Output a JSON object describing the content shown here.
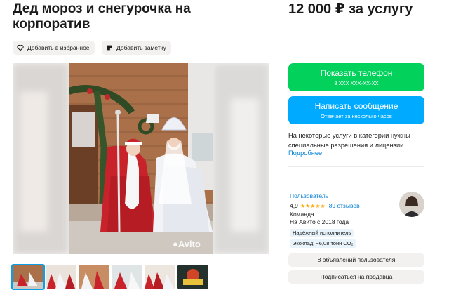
{
  "listing": {
    "title": "Дед мороз и снегурочка на корпоратив",
    "price": "12 000 ₽ за услугу"
  },
  "actions": {
    "favorite_label": "Добавить в избранное",
    "note_label": "Добавить заметку"
  },
  "gallery": {
    "watermark": "Avito",
    "thumbnail_count": 6
  },
  "contact": {
    "phone_button": "Показать телефон",
    "phone_masked": "8 XXX XXX-XX-XX",
    "message_button": "Написать сообщение",
    "message_sub": "Отвечает за несколько часов"
  },
  "notice": {
    "text": "На некоторые услуги в категории нужны специальные разрешения и лицензии.",
    "link": "Подробнее"
  },
  "seller": {
    "name": "Пользователь",
    "rating": "4,9",
    "stars": "★★★★★",
    "reviews": "89 отзывов",
    "type": "Команда",
    "since": "На Авито с 2018 года",
    "badge_reliable": "Надёжный исполнитель",
    "badge_eco": "Экоклад: −6,08 тонн CO₂",
    "listings_button": "8 объявлений пользователя",
    "subscribe_button": "Подписаться на продавца"
  },
  "colors": {
    "green": "#02d15c",
    "blue": "#00aaff",
    "link": "#0a82d6",
    "star": "#ffa600"
  }
}
